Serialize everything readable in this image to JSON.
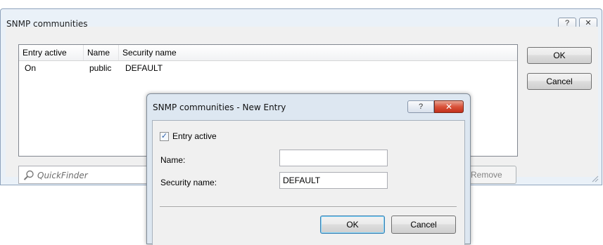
{
  "window": {
    "title": "SNMP communities",
    "help_glyph": "?",
    "close_glyph": "✕"
  },
  "table": {
    "headers": [
      "Entry active",
      "Name",
      "Security name"
    ],
    "rows": [
      [
        "On",
        "public",
        "DEFAULT"
      ]
    ]
  },
  "buttons": {
    "ok": "OK",
    "cancel": "Cancel",
    "remove": "Remove"
  },
  "quickfinder": {
    "placeholder": "QuickFinder"
  },
  "dialog": {
    "title": "SNMP communities - New Entry",
    "help_glyph": "?",
    "close_glyph": "✕",
    "entry_active_label": "Entry active",
    "entry_active_checked": true,
    "name_label": "Name:",
    "name_value": "",
    "security_name_label": "Security name:",
    "security_name_value": "DEFAULT",
    "ok": "OK",
    "cancel": "Cancel"
  },
  "colors": {
    "window_frame": "#eaf1f8",
    "dialog_close": "#c1301b"
  }
}
